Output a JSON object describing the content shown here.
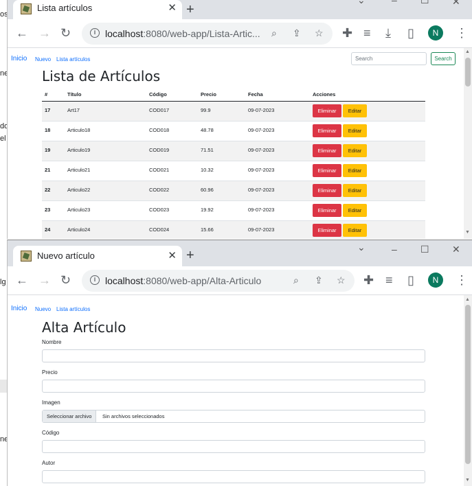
{
  "background": {
    "fragments": [
      "os",
      "ne",
      "do",
      "el c",
      "lg",
      "ne"
    ]
  },
  "window1": {
    "tab": {
      "title": "Lista artículos",
      "favicon": "app-favicon"
    },
    "url": {
      "host": "localhost",
      "path": ":8080/web-app/Lista-Artic..."
    },
    "nav": {
      "home": "Inicio",
      "new": "Nuevo",
      "list": "Lista artículos"
    },
    "search": {
      "placeholder": "Search",
      "button": "Search"
    },
    "page_title": "Lista de Artículos",
    "table": {
      "headers": [
        "#",
        "Título",
        "Código",
        "Precio",
        "Fecha",
        "Acciones"
      ],
      "rows": [
        {
          "id": "17",
          "title": "Art17",
          "code": "COD017",
          "price": "99.9",
          "date": "09-07-2023"
        },
        {
          "id": "18",
          "title": "Articulo18",
          "code": "COD018",
          "price": "48.78",
          "date": "09-07-2023"
        },
        {
          "id": "19",
          "title": "Articulo19",
          "code": "COD019",
          "price": "71.51",
          "date": "09-07-2023"
        },
        {
          "id": "21",
          "title": "Articulo21",
          "code": "COD021",
          "price": "10.32",
          "date": "09-07-2023"
        },
        {
          "id": "22",
          "title": "Articulo22",
          "code": "COD022",
          "price": "60.96",
          "date": "09-07-2023"
        },
        {
          "id": "23",
          "title": "Articulo23",
          "code": "COD023",
          "price": "19.92",
          "date": "09-07-2023"
        },
        {
          "id": "24",
          "title": "Articulo24",
          "code": "COD024",
          "price": "15.66",
          "date": "09-07-2023"
        }
      ],
      "delete_label": "Eliminar",
      "edit_label": "Editar"
    }
  },
  "window2": {
    "tab": {
      "title": "Nuevo artículo",
      "favicon": "app-favicon"
    },
    "url": {
      "host": "localhost",
      "path": ":8080/web-app/Alta-Articulo"
    },
    "nav": {
      "home": "Inicio",
      "new": "Nuevo",
      "list": "Lista artículos"
    },
    "page_title": "Alta Artículo",
    "form": {
      "name_label": "Nombre",
      "price_label": "Precio",
      "image_label": "Imagen",
      "file_button": "Seleccionar archivo",
      "file_status": "Sin archivos seleccionados",
      "code_label": "Código",
      "author_label": "Autor"
    }
  },
  "browser": {
    "avatar_letter": "N",
    "accent_color": "#0b7a5f"
  }
}
